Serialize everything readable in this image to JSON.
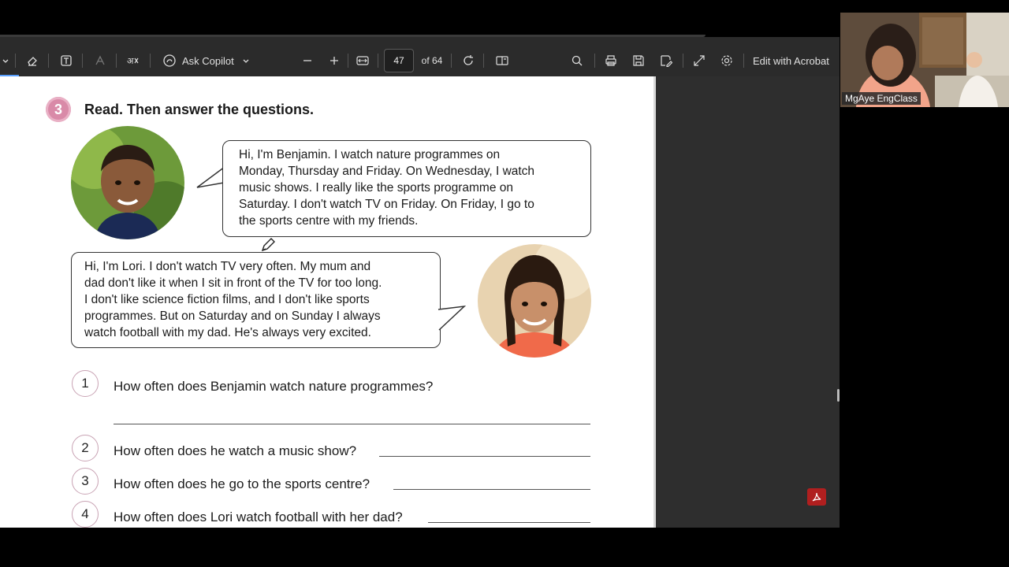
{
  "toolbar": {
    "ask_copilot": "Ask Copilot",
    "page_current": "47",
    "page_total": "of 64",
    "edit_with_acrobat": "Edit with Acrobat",
    "icons": [
      "chevron-down-icon",
      "eraser-icon",
      "text-box-icon",
      "highlight-icon",
      "read-aloud-icon",
      "copilot-icon",
      "zoom-out-icon",
      "zoom-in-icon",
      "fit-width-icon",
      "rotate-icon",
      "two-page-icon",
      "search-icon",
      "print-icon",
      "save-icon",
      "save-as-icon",
      "fullscreen-icon",
      "settings-icon"
    ]
  },
  "exercise": {
    "number": "3",
    "title": "Read. Then answer the questions."
  },
  "benjamin": {
    "text": "Hi, I'm Benjamin. I watch nature programmes on\nMonday, Thursday and Friday. On Wednesday, I watch\nmusic shows. I really like the sports programme on\nSaturday. I don't watch TV on Friday. On Friday, I go to\nthe sports centre with my friends."
  },
  "lori": {
    "text": "Hi, I'm Lori. I don't watch TV very often. My mum and\ndad don't like it when I sit in front of the TV for too long.\nI don't like science fiction films, and I don't like sports\nprogrammes. But on Saturday and on Sunday I always\nwatch football with my dad. He's always very excited."
  },
  "questions": [
    {
      "num": "1",
      "text": "How often does Benjamin watch nature programmes?"
    },
    {
      "num": "2",
      "text": "How often does he watch a music show?"
    },
    {
      "num": "3",
      "text": "How often does he go to the sports centre?"
    },
    {
      "num": "4",
      "text": "How often does Lori watch football with her dad?"
    }
  ],
  "webcam": {
    "label": "MgAye EngClass"
  }
}
